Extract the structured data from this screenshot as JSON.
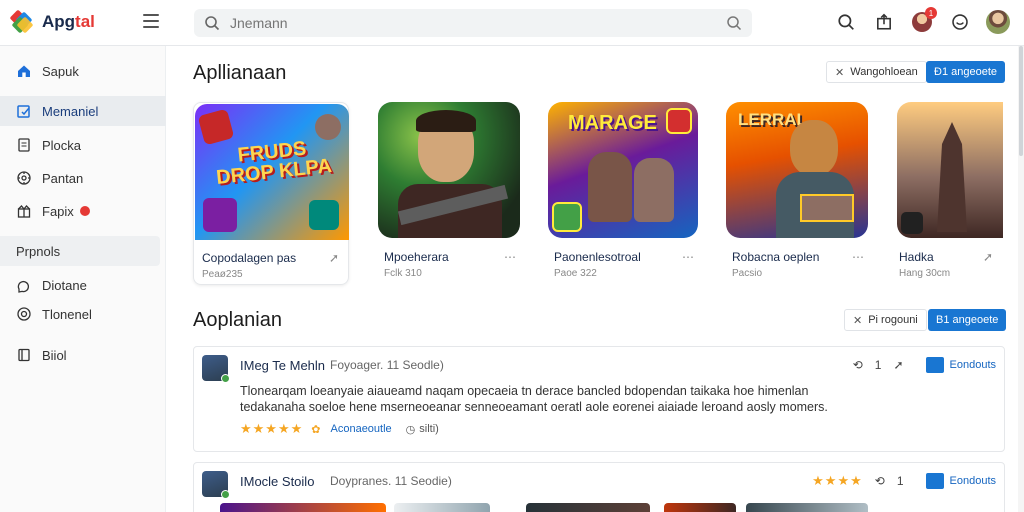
{
  "app": {
    "logo_text_a": "Apg",
    "logo_text_b": "tal"
  },
  "search": {
    "placeholder": "Jnemann"
  },
  "header": {
    "notification_count": "1"
  },
  "sidebar": {
    "items": [
      {
        "label": "Sapuk",
        "icon": "home-icon"
      },
      {
        "label": "Memaniel",
        "icon": "edit-icon",
        "active": true
      },
      {
        "label": "Plocka",
        "icon": "document-icon"
      },
      {
        "label": "Pantan",
        "icon": "gear-icon"
      },
      {
        "label": "Fapix",
        "icon": "gift-icon"
      }
    ],
    "section": "Prpnols",
    "items2": [
      {
        "label": "Diotane",
        "icon": "info-icon"
      },
      {
        "label": "Tlonenel",
        "icon": "target-icon"
      },
      {
        "label": "Biiol",
        "icon": "book-icon"
      }
    ]
  },
  "section1": {
    "title": "Apllianaan",
    "outline_btn": "Wangohloean",
    "blue_btn": "Ð1 angeoete"
  },
  "apps": [
    {
      "name": "Copodalagen pas",
      "meta": "Peaø235",
      "thumb_text": "FRUDS DROP KLPA"
    },
    {
      "name": "Mpoeherara",
      "meta": "Fclk 310",
      "thumb_text": ""
    },
    {
      "name": "Paonenlesotroal",
      "meta": "Paoe 322",
      "thumb_text": "MARAGE"
    },
    {
      "name": "Robacna oeplen",
      "meta": "Pacsio",
      "thumb_text": "LERRAL"
    },
    {
      "name": "Hadka",
      "meta": "Hang 30cm",
      "thumb_text": ""
    }
  ],
  "section2": {
    "title": "Aoplanian",
    "outline_btn": "Pi rogouni",
    "blue_btn": "B1 angeoete"
  },
  "reviews": [
    {
      "name": "IMeg Te Mehln",
      "time": "Foyoager.  11 Seodle)",
      "text": "Tlonearqam loeanyaie aiaueamd naqam opecaeia tn derace bancled bdopendan taikaka hoe himenlan tedakanaha soeloe hene mserneoeanar senneoeamant oeratl aole eorenei aiaiade leroand aosly momers.",
      "stars": "★★★★★",
      "link": "Aconaeoutle",
      "count": "silti)",
      "likes": "1",
      "follow": "Eondouts"
    },
    {
      "name": "IMocle Stoilo",
      "time": "Doypranes.  11 Seodie)",
      "stars": "★★★★",
      "likes": "1",
      "follow": "Eondouts"
    }
  ],
  "colors": {
    "accent": "#1976d2",
    "star": "#f5a623",
    "danger": "#e53935"
  }
}
